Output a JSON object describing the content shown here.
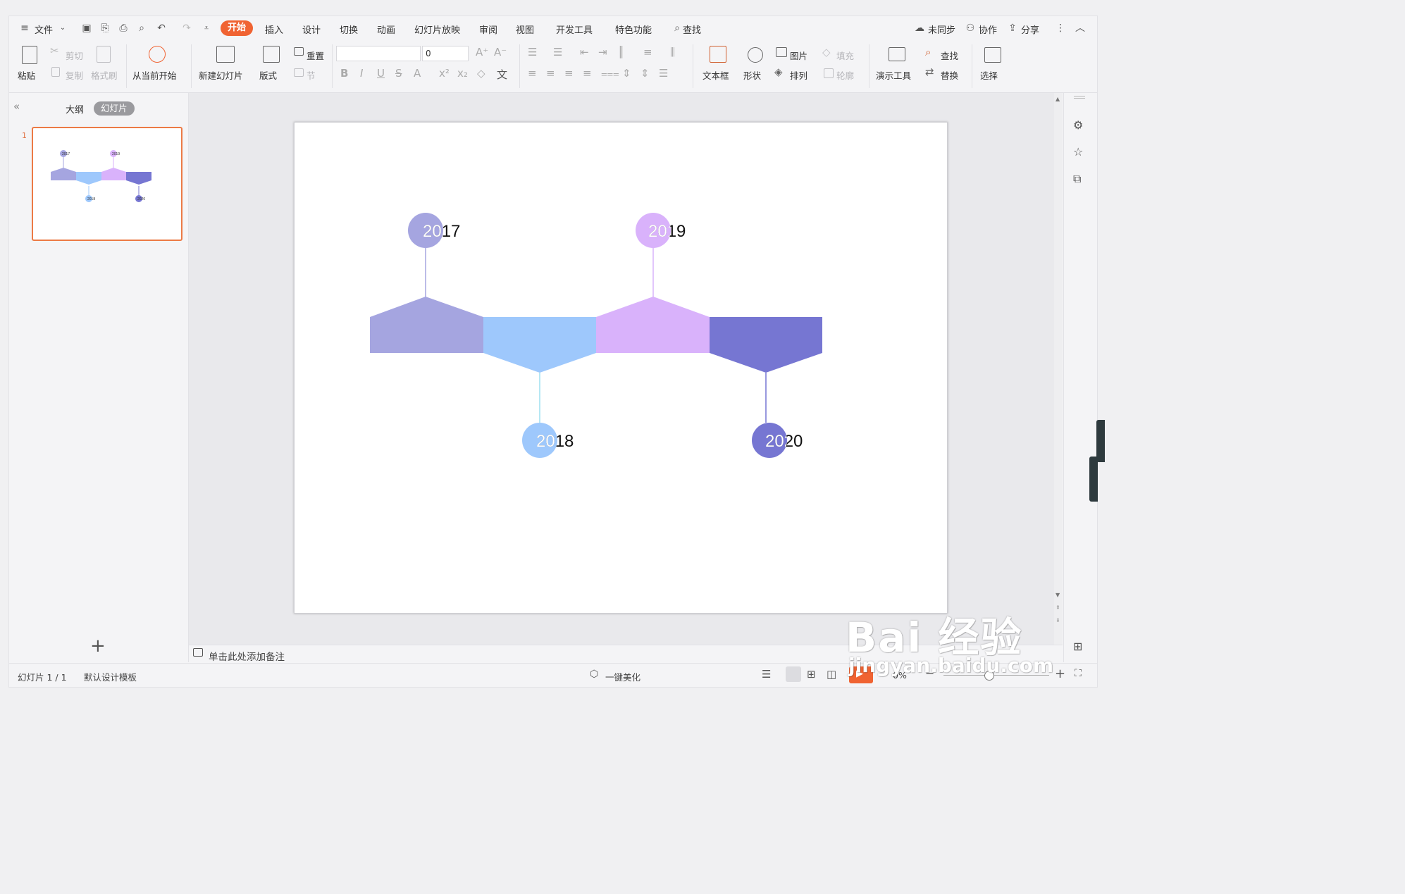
{
  "menu": {
    "file": "文件",
    "tabs": [
      "开始",
      "插入",
      "设计",
      "切换",
      "动画",
      "幻灯片放映",
      "审阅",
      "视图",
      "开发工具",
      "特色功能"
    ],
    "search": "查找",
    "sync": "未同步",
    "collab": "协作",
    "share": "分享"
  },
  "ribbon": {
    "paste": "粘贴",
    "cut": "剪切",
    "copy": "复制",
    "format_painter": "格式刷",
    "play_from_current": "从当前开始",
    "new_slide": "新建幻灯片",
    "layout": "版式",
    "reset": "重置",
    "section": "节",
    "font_size": "0",
    "text_box": "文本框",
    "shape": "形状",
    "picture": "图片",
    "fill": "填充",
    "arrange": "排列",
    "outline": "轮廓",
    "present_tools": "演示工具",
    "find": "查找",
    "replace": "替换",
    "select": "选择"
  },
  "left_panel": {
    "outline_tab": "大纲",
    "slides_tab": "幻灯片",
    "slide_number": "1"
  },
  "slide": {
    "timeline": [
      {
        "year": "2017",
        "color": "#a5a5e0",
        "position": "top"
      },
      {
        "year": "2018",
        "color": "#9ec8fc",
        "position": "bottom"
      },
      {
        "year": "2019",
        "color": "#d9b2fb",
        "position": "top"
      },
      {
        "year": "2020",
        "color": "#7676d2",
        "position": "bottom"
      }
    ]
  },
  "notes": {
    "placeholder": "单击此处添加备注"
  },
  "status": {
    "slide_counter": "幻灯片 1 / 1",
    "template": "默认设计模板",
    "beautify": "一键美化",
    "zoom": "0%"
  },
  "watermark": {
    "logo": "Bai 经验",
    "url": "jingyan.baidu.com"
  },
  "colors": {
    "accent": "#f06332",
    "thumb_border": "#ec7a45"
  }
}
